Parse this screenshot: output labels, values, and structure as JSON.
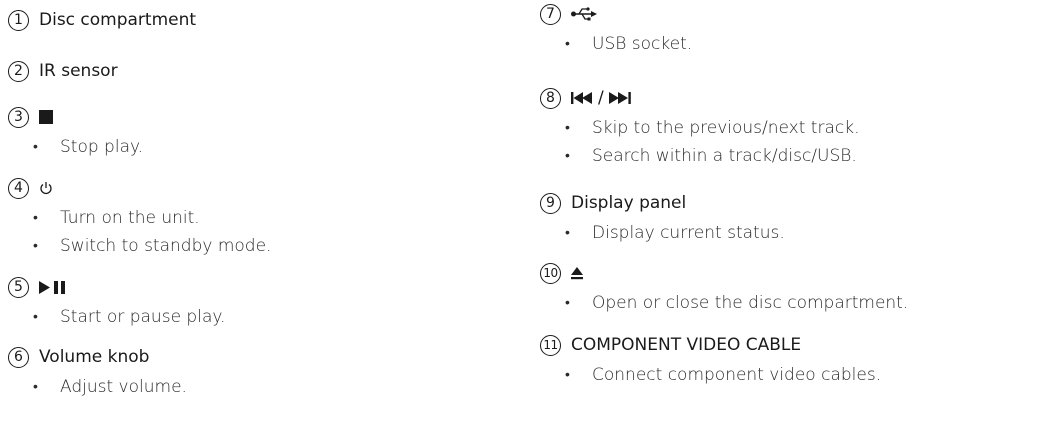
{
  "left": {
    "items": [
      {
        "num": "1",
        "title": "Disc compartment",
        "bullets": []
      },
      {
        "num": "2",
        "title": "IR sensor",
        "bullets": []
      },
      {
        "num": "3",
        "icon": "stop-icon",
        "bullets": [
          "Stop play."
        ]
      },
      {
        "num": "4",
        "icon": "power-icon",
        "bullets": [
          "Turn on the unit.",
          "Switch to standby mode."
        ]
      },
      {
        "num": "5",
        "icon": "play-pause-icon",
        "bullets": [
          "Start or pause play."
        ]
      },
      {
        "num": "6",
        "title": "Volume knob",
        "bullets": [
          "Adjust volume."
        ]
      }
    ]
  },
  "right": {
    "items": [
      {
        "num": "7",
        "icon": "usb-icon",
        "bullets": [
          "USB socket."
        ]
      },
      {
        "num": "8",
        "icon": "skip-prev-next-icon",
        "title": "/",
        "bullets": [
          "Skip to the previous/next track.",
          "Search within a track/disc/USB."
        ]
      },
      {
        "num": "9",
        "title": "Display panel",
        "bullets": [
          "Display current status."
        ]
      },
      {
        "num": "10",
        "icon": "eject-icon",
        "bullets": [
          "Open or close the disc compartment."
        ]
      },
      {
        "num": "11",
        "title": "COMPONENT VIDEO CABLE",
        "bullets": [
          "Connect component video cables."
        ]
      }
    ]
  },
  "bullet_char": "•"
}
